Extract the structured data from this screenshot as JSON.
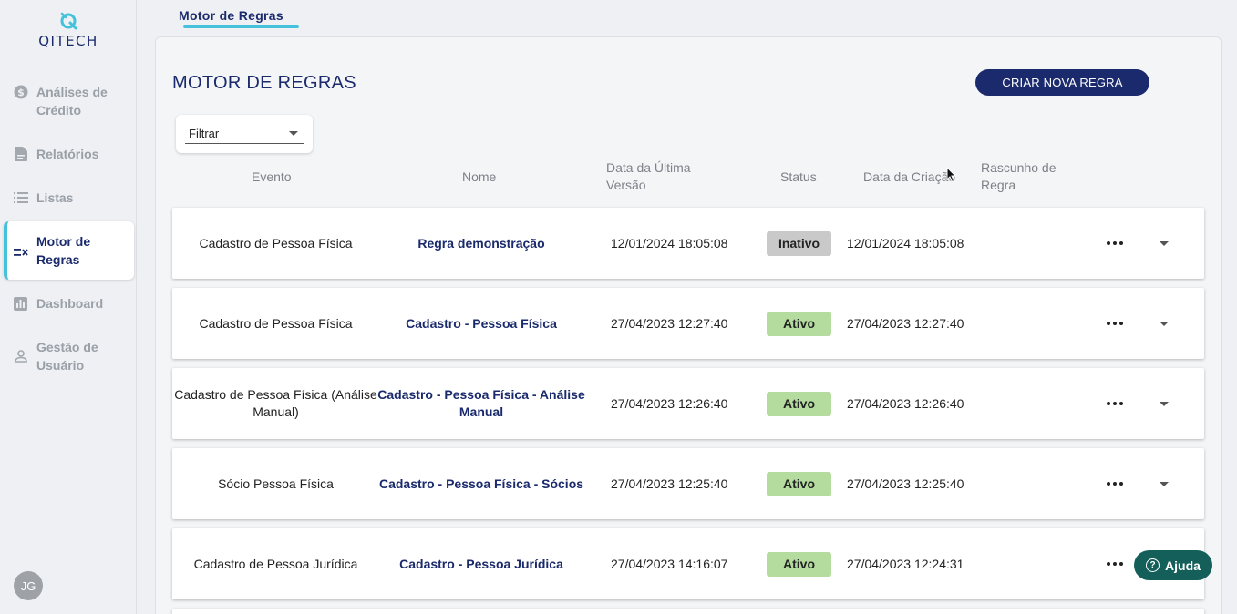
{
  "brand": {
    "name": "QITECH"
  },
  "sidebar": {
    "items": [
      {
        "label": "Análises de Crédito",
        "icon": "dollar-circle-icon"
      },
      {
        "label": "Relatórios",
        "icon": "report-icon"
      },
      {
        "label": "Listas",
        "icon": "list-icon"
      },
      {
        "label": "Motor de Regras",
        "icon": "rules-icon",
        "active": true
      },
      {
        "label": "Dashboard",
        "icon": "bar-chart-icon"
      },
      {
        "label": "Gestão de Usuário",
        "icon": "user-icon"
      }
    ],
    "avatar_initials": "JG"
  },
  "tab": {
    "label": "Motor de Regras"
  },
  "page": {
    "title": "MOTOR DE REGRAS",
    "create_button": "CRIAR NOVA REGRA"
  },
  "filter": {
    "value": "Filtrar"
  },
  "table": {
    "headers": {
      "event": "Evento",
      "name": "Nome",
      "last_version": "Data da Última Versão",
      "status": "Status",
      "created": "Data da Criação",
      "draft": "Rascunho de Regra"
    },
    "rows": [
      {
        "event": "Cadastro de Pessoa Física",
        "name": "Regra demonstração",
        "last_version": "12/01/2024 18:05:08",
        "status": "Inativo",
        "created": "12/01/2024 18:05:08"
      },
      {
        "event": "Cadastro de Pessoa Física",
        "name": "Cadastro - Pessoa Física",
        "last_version": "27/04/2023 12:27:40",
        "status": "Ativo",
        "created": "27/04/2023 12:27:40"
      },
      {
        "event": "Cadastro de Pessoa Física (Análise Manual)",
        "name": "Cadastro - Pessoa Física - Análise Manual",
        "last_version": "27/04/2023 12:26:40",
        "status": "Ativo",
        "created": "27/04/2023 12:26:40"
      },
      {
        "event": "Sócio Pessoa Física",
        "name": "Cadastro - Pessoa Física - Sócios",
        "last_version": "27/04/2023 12:25:40",
        "status": "Ativo",
        "created": "27/04/2023 12:25:40"
      },
      {
        "event": "Cadastro de Pessoa Jurídica",
        "name": "Cadastro - Pessoa Jurídica",
        "last_version": "27/04/2023 14:16:07",
        "status": "Ativo",
        "created": "27/04/2023 12:24:31"
      }
    ]
  },
  "status_colors": {
    "Ativo": "#b3dc9e",
    "Inativo": "#c9c9c9"
  },
  "help": {
    "label": "Ajuda"
  }
}
